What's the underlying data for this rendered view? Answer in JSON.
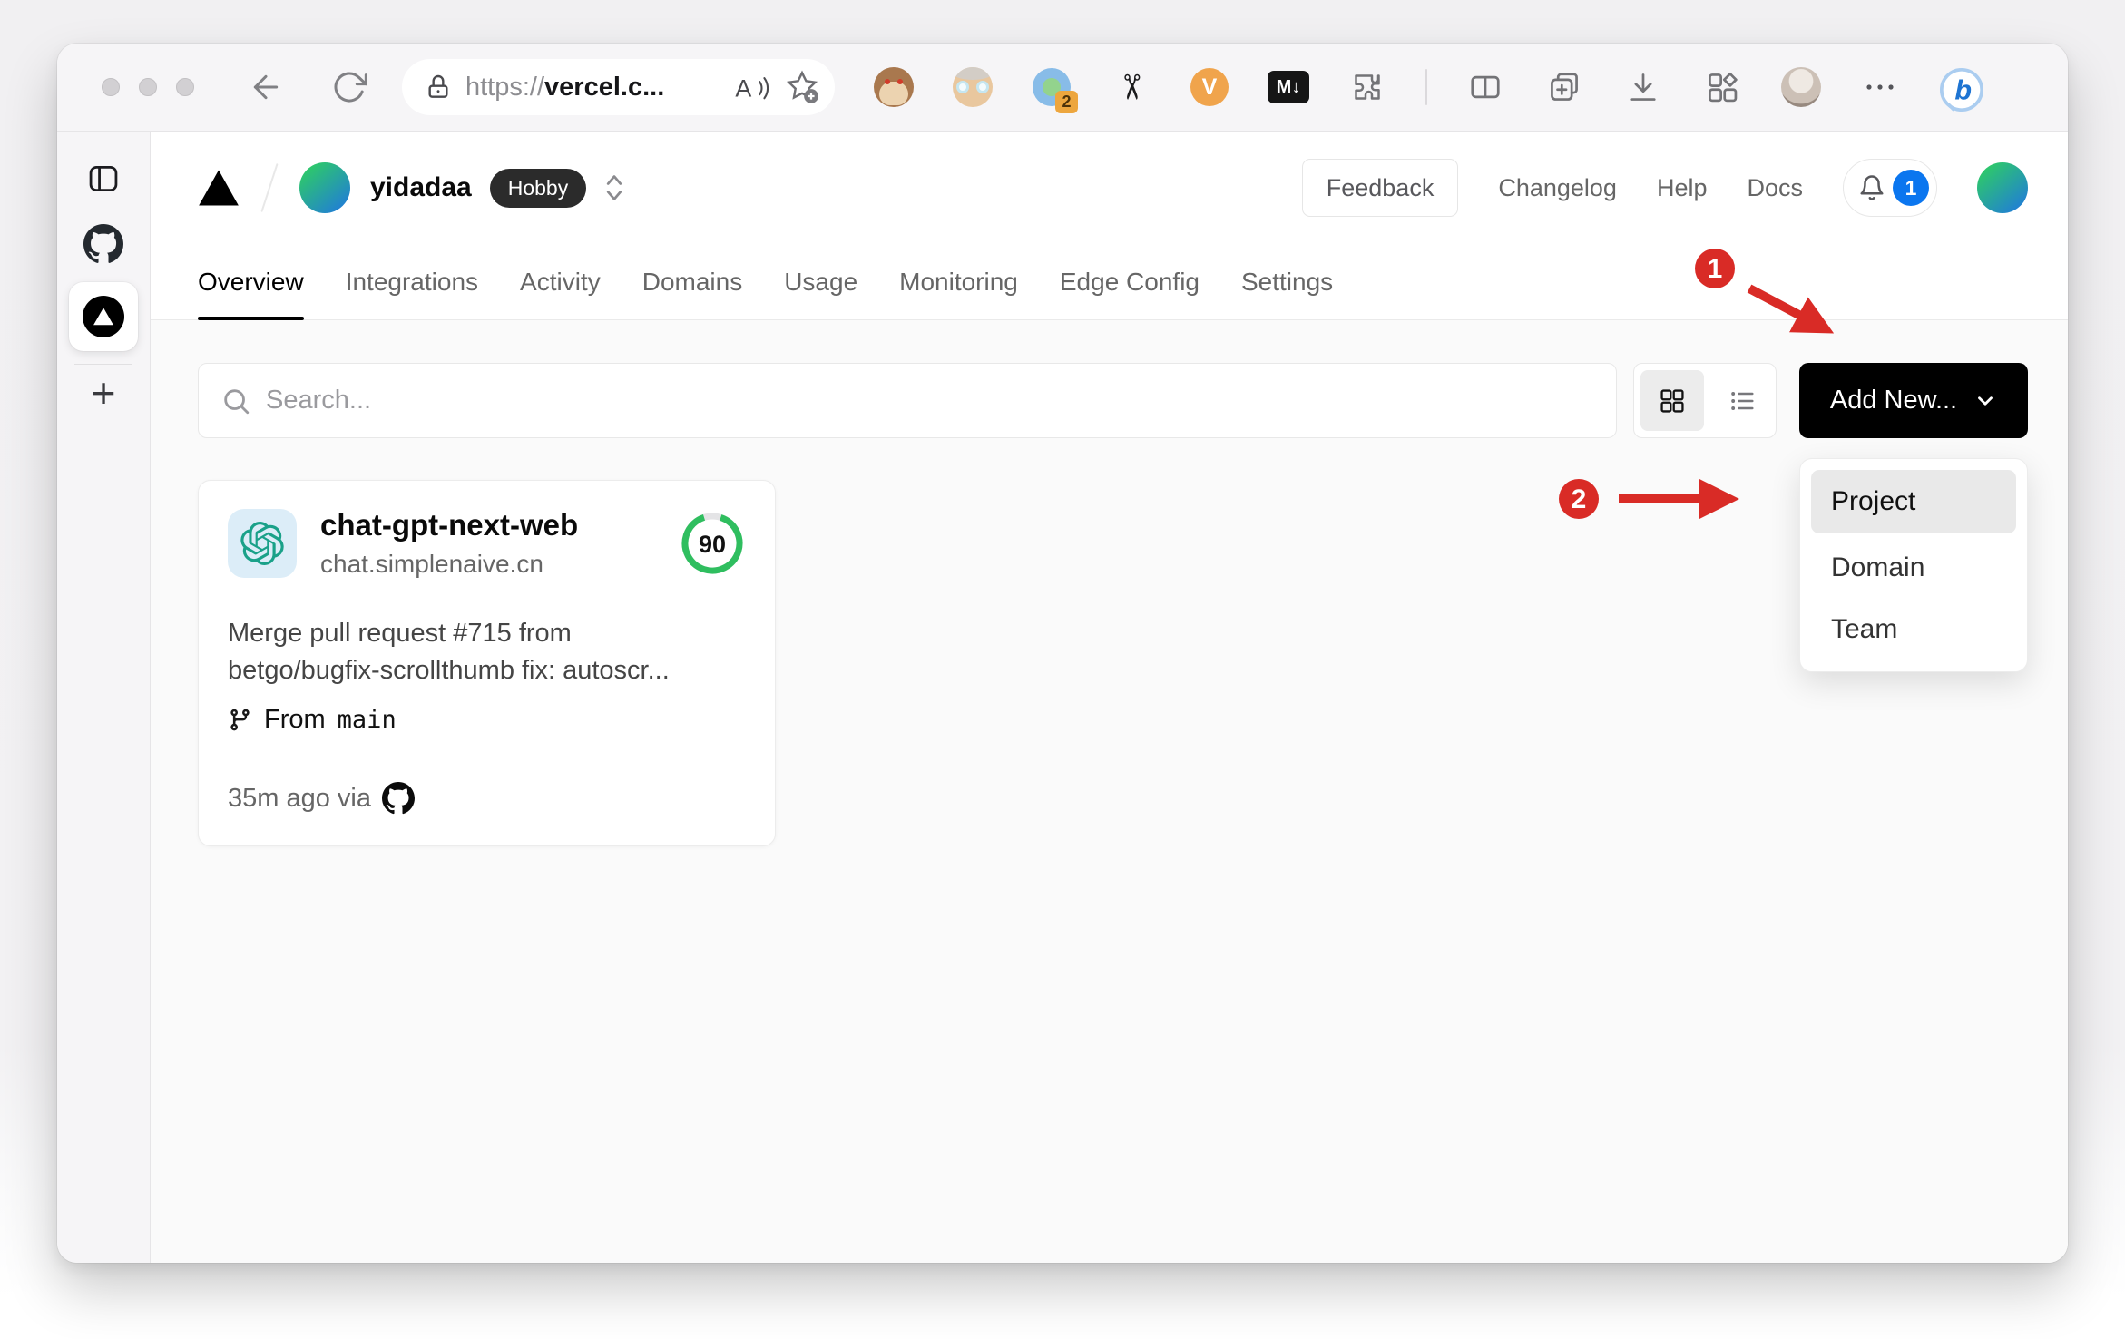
{
  "browser": {
    "address_bar": {
      "scheme": "https://",
      "host": "vercel.c..."
    },
    "reader_glyph": "A",
    "extensions": {
      "proxy_badge": "2",
      "scissors_glyph": "✂",
      "video_label": "V",
      "markdown_label": "M↓",
      "bing_label": "b"
    },
    "new_tab_label": "+"
  },
  "site": {
    "header": {
      "team_name": "yidadaa",
      "plan_badge": "Hobby",
      "feedback_label": "Feedback",
      "links": [
        {
          "label": "Changelog"
        },
        {
          "label": "Help"
        },
        {
          "label": "Docs"
        }
      ],
      "notification_count": "1"
    },
    "tabs": [
      {
        "label": "Overview",
        "active": true
      },
      {
        "label": "Integrations"
      },
      {
        "label": "Activity"
      },
      {
        "label": "Domains"
      },
      {
        "label": "Usage"
      },
      {
        "label": "Monitoring"
      },
      {
        "label": "Edge Config"
      },
      {
        "label": "Settings"
      }
    ],
    "controls": {
      "search_placeholder": "Search...",
      "add_new_label": "Add New..."
    },
    "add_new_menu": {
      "items": [
        {
          "label": "Project",
          "highlighted": true
        },
        {
          "label": "Domain",
          "highlighted": false
        },
        {
          "label": "Team",
          "highlighted": false
        }
      ]
    },
    "project_card": {
      "name": "chat-gpt-next-web",
      "domain": "chat.simplenaive.cn",
      "score": "90",
      "commit_line1": "Merge pull request #715 from",
      "commit_line2": "betgo/bugfix-scrollthumb fix: autoscr...",
      "branch_label": "From",
      "branch_name": "main",
      "deployed_meta": "35m ago via"
    }
  },
  "annotations": {
    "step1": "1",
    "step2": "2",
    "arrow_color": "#d92b26"
  },
  "icons": {
    "search": "magnifier",
    "grid-view": "2x2 squares",
    "list-view": "rows",
    "bell": "bell outline",
    "git-branch": "branch",
    "github": "octocat mark",
    "openai": "knot logo",
    "vercel": "black triangle"
  },
  "colors": {
    "accent_red": "#d92b26",
    "score_green": "#2fbe5f",
    "notification_blue": "#0b76ef",
    "openai_teal": "#1aa189",
    "avatar_gradient_start": "#2fd05f",
    "avatar_gradient_end": "#2079dd",
    "page_bg": "#fafafa"
  }
}
